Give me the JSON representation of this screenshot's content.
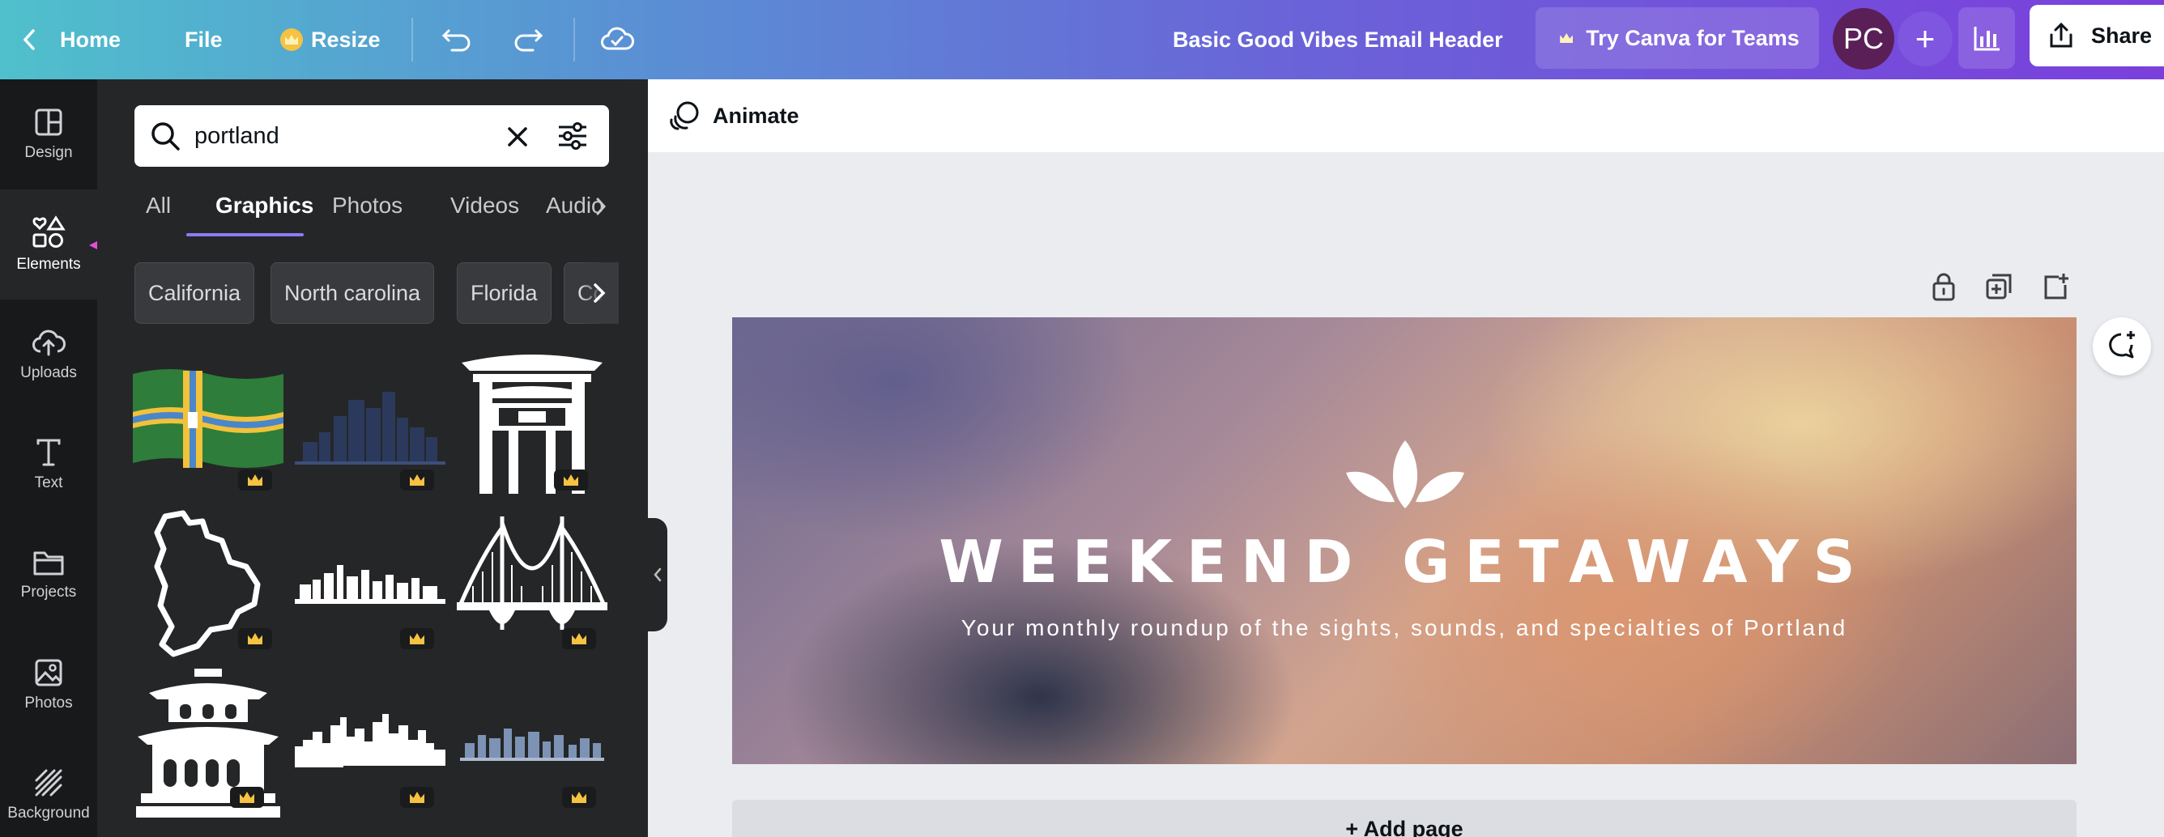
{
  "topbar": {
    "home_label": "Home",
    "file_label": "File",
    "resize_label": "Resize",
    "doc_title": "Basic Good Vibes Email Header",
    "teams_label": "Try Canva for Teams",
    "avatar_initials": "PC",
    "share_label": "Share"
  },
  "rail": {
    "items": [
      {
        "label": "Design"
      },
      {
        "label": "Elements"
      },
      {
        "label": "Uploads"
      },
      {
        "label": "Text"
      },
      {
        "label": "Projects"
      },
      {
        "label": "Photos"
      },
      {
        "label": "Background"
      }
    ]
  },
  "panel": {
    "search_value": "portland",
    "tabs": [
      "All",
      "Graphics",
      "Photos",
      "Videos",
      "Audio"
    ],
    "active_tab": "Graphics",
    "chips": [
      "California",
      "North carolina",
      "Florida",
      "Co"
    ],
    "graphics": [
      {
        "name": "portland-flag",
        "premium": true
      },
      {
        "name": "city-skyline-blue",
        "premium": true
      },
      {
        "name": "chinatown-gate",
        "premium": true
      },
      {
        "name": "oregon-state-outline",
        "premium": true
      },
      {
        "name": "skyline-white-thin",
        "premium": true
      },
      {
        "name": "st-johns-bridge",
        "premium": true
      },
      {
        "name": "pagoda-temple",
        "premium": true
      },
      {
        "name": "skyline-white-solid",
        "premium": true
      },
      {
        "name": "skyline-blue-small",
        "premium": true
      }
    ]
  },
  "canvas": {
    "animate_label": "Animate",
    "design_title": "WEEKEND GETAWAYS",
    "design_subtitle": "Your monthly roundup of the sights, sounds, and specialties of Portland",
    "add_page_label": "+ Add page"
  },
  "colors": {
    "accent": "#8b7cf6",
    "annotation_arrow": "#e74fd8",
    "premium_crown": "#f5c242"
  }
}
